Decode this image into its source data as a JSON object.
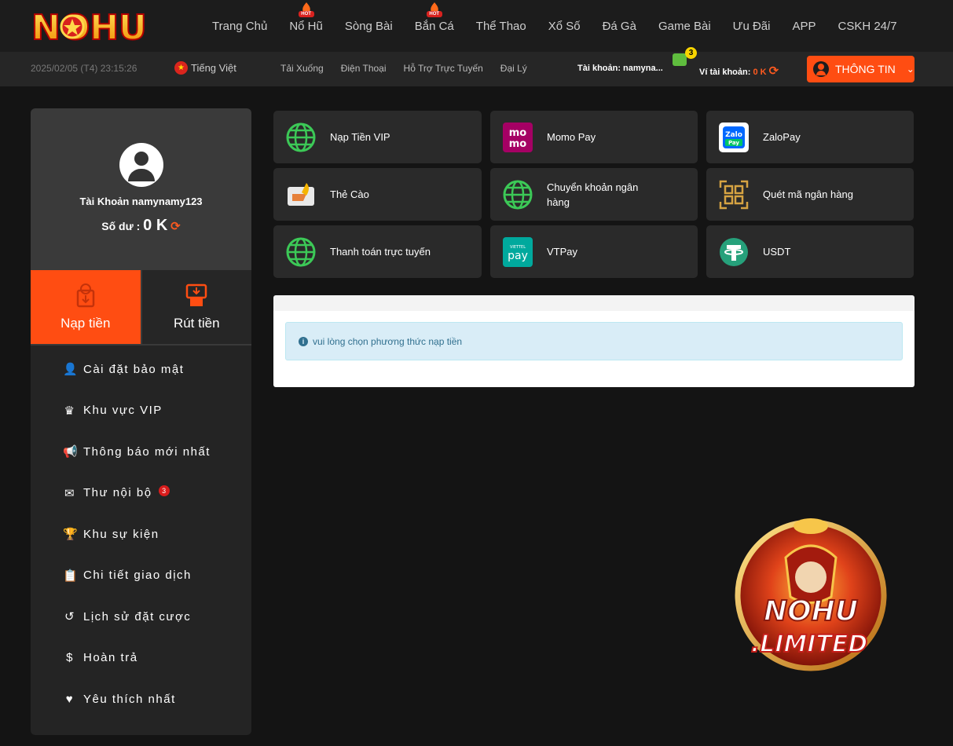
{
  "brand": {
    "logo_text": "NOHU",
    "accent": "#ff4d12"
  },
  "nav": {
    "items": [
      {
        "label": "Trang Chủ",
        "hot": false
      },
      {
        "label": "Nổ Hũ",
        "hot": true
      },
      {
        "label": "Sòng Bài",
        "hot": false
      },
      {
        "label": "Bắn Cá",
        "hot": true
      },
      {
        "label": "Thể Thao",
        "hot": false
      },
      {
        "label": "Xổ Số",
        "hot": false
      },
      {
        "label": "Đá Gà",
        "hot": false
      },
      {
        "label": "Game Bài",
        "hot": false
      },
      {
        "label": "Ưu Đãi",
        "hot": false
      },
      {
        "label": "APP",
        "hot": false
      },
      {
        "label": "CSKH 24/7",
        "hot": false
      }
    ],
    "hot_badge": "HOT"
  },
  "subbar": {
    "datetime": "2025/02/05 (T4) 23:15:26",
    "language": "Tiếng Việt",
    "links": [
      "Tải Xuống",
      "Điện Thoại",
      "Hỗ Trợ Trực Tuyến",
      "Đại Lý"
    ],
    "account_label": "Tài khoản: namyna...",
    "message_count": "3",
    "wallet_label": "Ví tài khoản: ",
    "wallet_amount": "0 K",
    "info_button": "THÔNG TIN"
  },
  "profile": {
    "username": "Tài Khoản namynamy123",
    "balance_label": "Số dư : ",
    "balance_value": "0 K"
  },
  "tabs": {
    "deposit": "Nạp tiền",
    "withdraw": "Rút tiền"
  },
  "side_menu": [
    {
      "label": "Cài đặt bảo mật",
      "icon": "user-lock-icon",
      "glyph": "👤"
    },
    {
      "label": "Khu vực VIP",
      "icon": "crown-icon",
      "glyph": "♛"
    },
    {
      "label": "Thông báo mới nhất",
      "icon": "megaphone-icon",
      "glyph": "📢"
    },
    {
      "label": "Thư nội bộ",
      "icon": "envelope-icon",
      "glyph": "✉",
      "badge": "3"
    },
    {
      "label": "Khu sự kiện",
      "icon": "trophy-icon",
      "glyph": "🏆"
    },
    {
      "label": "Chi tiết giao dịch",
      "icon": "clipboard-icon",
      "glyph": "📋"
    },
    {
      "label": "Lịch sử đặt cược",
      "icon": "history-icon",
      "glyph": "↺"
    },
    {
      "label": "Hoàn trả",
      "icon": "dollar-circle-icon",
      "glyph": "$"
    },
    {
      "label": "Yêu thích nhất",
      "icon": "heart-icon",
      "glyph": "♥"
    }
  ],
  "payments": [
    {
      "label": "Nạp Tiền VIP",
      "icon": "globe-icon"
    },
    {
      "label": "Momo Pay",
      "icon": "momo-icon"
    },
    {
      "label": "ZaloPay",
      "icon": "zalopay-icon"
    },
    {
      "label": "Thẻ Cào",
      "icon": "card-icon"
    },
    {
      "label": "Chuyển khoản ngân hàng",
      "icon": "globe-icon"
    },
    {
      "label": "Quét mã ngân hàng",
      "icon": "qr-icon"
    },
    {
      "label": "Thanh toán trực tuyến",
      "icon": "globe-icon"
    },
    {
      "label": "VTPay",
      "icon": "vtpay-icon"
    },
    {
      "label": "USDT",
      "icon": "tether-icon"
    }
  ],
  "notice": "vui lòng chọn phương thức nạp tiền",
  "promo": {
    "line1": "NOHU",
    "line2": ".LIMITED"
  }
}
